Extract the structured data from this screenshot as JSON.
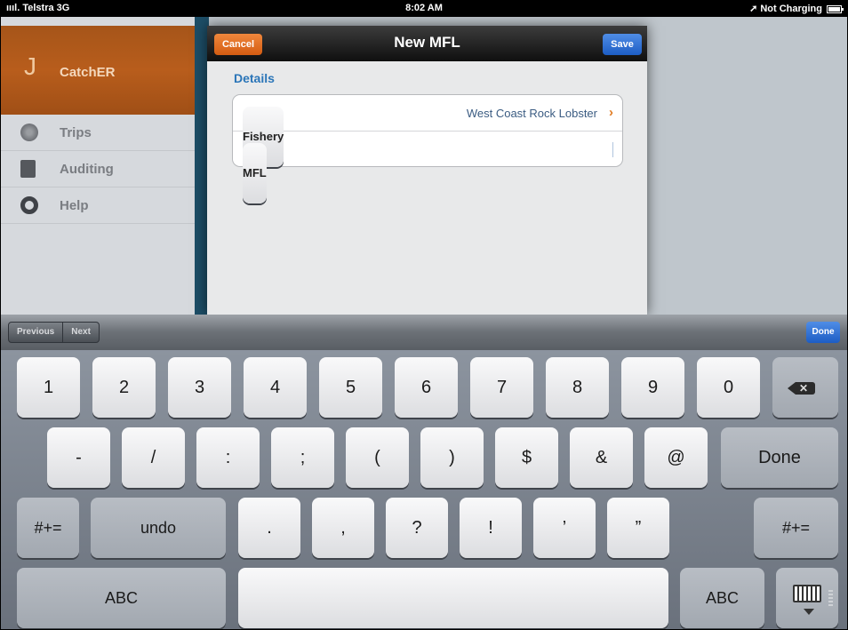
{
  "status_bar": {
    "carrier": "ıııl. Telstra  3G",
    "time": "8:02 AM",
    "charging": "➚ Not Charging"
  },
  "sidebar": {
    "app_name": "CatchER",
    "items": [
      {
        "label": "Trips",
        "icon": "globe-icon"
      },
      {
        "label": "Auditing",
        "icon": "document-icon"
      },
      {
        "label": "Help",
        "icon": "lifebuoy-icon"
      }
    ]
  },
  "modal": {
    "title": "New MFL",
    "cancel_label": "Cancel",
    "save_label": "Save",
    "section": "Details",
    "rows": [
      {
        "key": "Fishery",
        "value": "West Coast Rock Lobster"
      },
      {
        "key": "MFL",
        "value": ""
      }
    ]
  },
  "accessory": {
    "previous": "Previous",
    "next": "Next",
    "done": "Done"
  },
  "keyboard": {
    "row1": [
      "1",
      "2",
      "3",
      "4",
      "5",
      "6",
      "7",
      "8",
      "9",
      "0"
    ],
    "row2": [
      "-",
      "/",
      ":",
      ";",
      "(",
      ")",
      "$",
      "&",
      "@"
    ],
    "row2_done": "Done",
    "row3_left": "#+=",
    "row3_undo": "undo",
    "row3": [
      ".",
      ",",
      "?",
      "!",
      "’",
      "”"
    ],
    "row3_right": "#+=",
    "abc_left": "ABC",
    "abc_right": "ABC"
  },
  "colors": {
    "app_header": "#b85d1c",
    "cancel_button": "#e07a2a",
    "save_button": "#2f6fd6",
    "section_label": "#2a75b8",
    "value_text": "#3b5c82"
  }
}
